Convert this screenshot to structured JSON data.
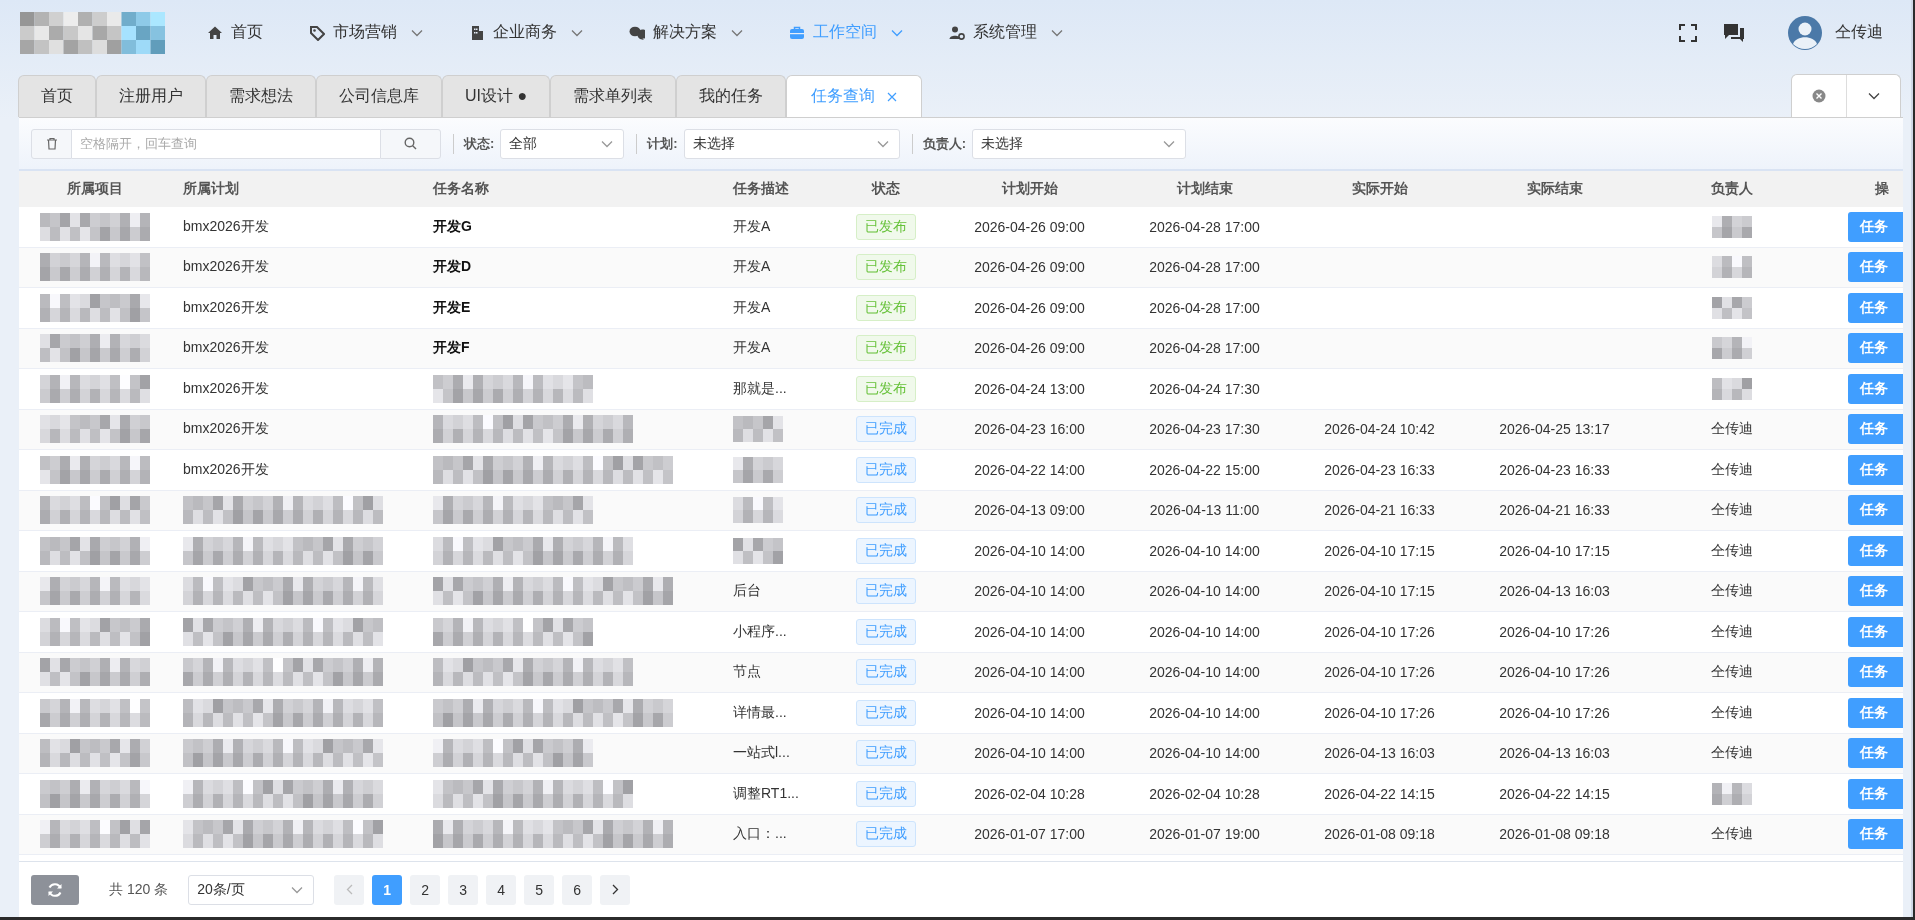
{
  "header": {
    "logo": {
      "redacted": true
    },
    "nav": [
      {
        "label": "首页",
        "has_menu": false,
        "selected": false
      },
      {
        "label": "市场营销",
        "has_menu": true,
        "selected": false
      },
      {
        "label": "企业商务",
        "has_menu": true,
        "selected": false
      },
      {
        "label": "解决方案",
        "has_menu": true,
        "selected": false
      },
      {
        "label": "工作空间",
        "has_menu": true,
        "selected": true
      },
      {
        "label": "系统管理",
        "has_menu": true,
        "selected": false
      }
    ],
    "user": {
      "name": "仝传迪"
    }
  },
  "tabs": [
    {
      "label": "首页",
      "selected": false
    },
    {
      "label": "注册用户",
      "selected": false
    },
    {
      "label": "需求想法",
      "selected": false
    },
    {
      "label": "公司信息库",
      "selected": false
    },
    {
      "label": "UI设计 ●",
      "selected": false
    },
    {
      "label": "需求单列表",
      "selected": false
    },
    {
      "label": "我的任务",
      "selected": false
    },
    {
      "label": "任务查询",
      "selected": true
    }
  ],
  "filters": {
    "search": {
      "placeholder": "空格隔开，回车查询"
    },
    "selects": [
      {
        "label": "状态:",
        "value": "全部"
      },
      {
        "label": "计划:",
        "value": "未选择"
      },
      {
        "label": "负责人:",
        "value": "未选择"
      }
    ]
  },
  "table": {
    "columns": [
      "所属项目",
      "所属计划",
      "任务名称",
      "任务描述",
      "状态",
      "计划开始",
      "计划结束",
      "实际开始",
      "实际结束",
      "负责人",
      "操"
    ],
    "rows": [
      {
        "project": {
          "redacted": true
        },
        "plan": "bmx2026开发",
        "task": "开发G",
        "bold": true,
        "desc": "开发A",
        "status": {
          "label": "已发布",
          "kind": "published"
        },
        "plan_start": "2026-04-26 09:00",
        "plan_end": "2026-04-28 17:00",
        "owner": {
          "redacted": true
        },
        "action": "任务"
      },
      {
        "project": {
          "redacted": true
        },
        "plan": "bmx2026开发",
        "task": "开发D",
        "bold": true,
        "desc": "开发A",
        "status": {
          "label": "已发布",
          "kind": "published"
        },
        "plan_start": "2026-04-26 09:00",
        "plan_end": "2026-04-28 17:00",
        "owner": {
          "redacted": true
        },
        "action": "任务"
      },
      {
        "project": {
          "redacted": true
        },
        "plan": "bmx2026开发",
        "task": "开发E",
        "bold": true,
        "desc": "开发A",
        "status": {
          "label": "已发布",
          "kind": "published"
        },
        "plan_start": "2026-04-26 09:00",
        "plan_end": "2026-04-28 17:00",
        "owner": {
          "redacted": true
        },
        "action": "任务"
      },
      {
        "project": {
          "redacted": true
        },
        "plan": "bmx2026开发",
        "task": "开发F",
        "bold": true,
        "desc": "开发A",
        "status": {
          "label": "已发布",
          "kind": "published"
        },
        "plan_start": "2026-04-26 09:00",
        "plan_end": "2026-04-28 17:00",
        "owner": {
          "redacted": true
        },
        "action": "任务"
      },
      {
        "project": {
          "redacted": true
        },
        "plan": "bmx2026开发",
        "task": {
          "redacted": true
        },
        "bold": false,
        "desc": "那就是...",
        "status": {
          "label": "已发布",
          "kind": "published"
        },
        "plan_start": "2026-04-24 13:00",
        "plan_end": "2026-04-24 17:30",
        "owner": {
          "redacted": true
        },
        "action": "任务"
      },
      {
        "project": {
          "redacted": true
        },
        "plan": "bmx2026开发",
        "task": {
          "redacted": true
        },
        "bold": false,
        "desc": {
          "redacted": true
        },
        "status": {
          "label": "已完成",
          "kind": "done"
        },
        "plan_start": "2026-04-23 16:00",
        "plan_end": "2026-04-23 17:30",
        "actual_start": "2026-04-24 10:42",
        "actual_end": "2026-04-25 13:17",
        "owner": "仝传迪",
        "action": "任务"
      },
      {
        "project": {
          "redacted": true
        },
        "plan": "bmx2026开发",
        "task": {
          "redacted": true
        },
        "bold": false,
        "desc": {
          "redacted": true
        },
        "status": {
          "label": "已完成",
          "kind": "done"
        },
        "plan_start": "2026-04-22 14:00",
        "plan_end": "2026-04-22 15:00",
        "actual_start": "2026-04-23 16:33",
        "actual_end": "2026-04-23 16:33",
        "owner": "仝传迪",
        "action": "任务"
      },
      {
        "project": {
          "redacted": true
        },
        "plan": {
          "redacted": true
        },
        "task": {
          "redacted": true
        },
        "bold": false,
        "desc": {
          "redacted": true
        },
        "status": {
          "label": "已完成",
          "kind": "done"
        },
        "plan_start": "2026-04-13 09:00",
        "plan_end": "2026-04-13 11:00",
        "actual_start": "2026-04-21 16:33",
        "actual_end": "2026-04-21 16:33",
        "owner": "仝传迪",
        "action": "任务"
      },
      {
        "project": {
          "redacted": true
        },
        "plan": {
          "redacted": true
        },
        "task": {
          "redacted": true
        },
        "bold": false,
        "desc": {
          "redacted": true
        },
        "status": {
          "label": "已完成",
          "kind": "done"
        },
        "plan_start": "2026-04-10 14:00",
        "plan_end": "2026-04-10 14:00",
        "actual_start": "2026-04-10 17:15",
        "actual_end": "2026-04-10 17:15",
        "owner": "仝传迪",
        "action": "任务"
      },
      {
        "project": {
          "redacted": true
        },
        "plan": {
          "redacted": true
        },
        "task": {
          "redacted": true
        },
        "bold": false,
        "desc": "后台",
        "status": {
          "label": "已完成",
          "kind": "done"
        },
        "plan_start": "2026-04-10 14:00",
        "plan_end": "2026-04-10 14:00",
        "actual_start": "2026-04-10 17:15",
        "actual_end": "2026-04-13 16:03",
        "owner": "仝传迪",
        "action": "任务"
      },
      {
        "project": {
          "redacted": true
        },
        "plan": {
          "redacted": true
        },
        "task": {
          "redacted": true
        },
        "bold": false,
        "desc": "小程序...",
        "status": {
          "label": "已完成",
          "kind": "done"
        },
        "plan_start": "2026-04-10 14:00",
        "plan_end": "2026-04-10 14:00",
        "actual_start": "2026-04-10 17:26",
        "actual_end": "2026-04-10 17:26",
        "owner": "仝传迪",
        "action": "任务"
      },
      {
        "project": {
          "redacted": true
        },
        "plan": {
          "redacted": true
        },
        "task": {
          "redacted": true
        },
        "bold": false,
        "desc": "节点",
        "status": {
          "label": "已完成",
          "kind": "done"
        },
        "plan_start": "2026-04-10 14:00",
        "plan_end": "2026-04-10 14:00",
        "actual_start": "2026-04-10 17:26",
        "actual_end": "2026-04-10 17:26",
        "owner": "仝传迪",
        "action": "任务"
      },
      {
        "project": {
          "redacted": true
        },
        "plan": {
          "redacted": true
        },
        "task": {
          "redacted": true
        },
        "bold": false,
        "desc": "详情最...",
        "status": {
          "label": "已完成",
          "kind": "done"
        },
        "plan_start": "2026-04-10 14:00",
        "plan_end": "2026-04-10 14:00",
        "actual_start": "2026-04-10 17:26",
        "actual_end": "2026-04-10 17:26",
        "owner": "仝传迪",
        "action": "任务"
      },
      {
        "project": {
          "redacted": true
        },
        "plan": {
          "redacted": true
        },
        "task": {
          "redacted": true
        },
        "bold": false,
        "desc": "一站式l...",
        "status": {
          "label": "已完成",
          "kind": "done"
        },
        "plan_start": "2026-04-10 14:00",
        "plan_end": "2026-04-10 14:00",
        "actual_start": "2026-04-13 16:03",
        "actual_end": "2026-04-13 16:03",
        "owner": "仝传迪",
        "action": "任务"
      },
      {
        "project": {
          "redacted": true
        },
        "plan": {
          "redacted": true
        },
        "task": {
          "redacted": true
        },
        "bold": false,
        "desc": "调整RT1...",
        "status": {
          "label": "已完成",
          "kind": "done"
        },
        "plan_start": "2026-02-04 10:28",
        "plan_end": "2026-02-04 10:28",
        "actual_start": "2026-04-22 14:15",
        "actual_end": "2026-04-22 14:15",
        "owner": {
          "redacted": true
        },
        "action": "任务"
      },
      {
        "project": {
          "redacted": true
        },
        "plan": {
          "redacted": true
        },
        "task": {
          "redacted": true
        },
        "bold": false,
        "desc": "入口：...",
        "status": {
          "label": "已完成",
          "kind": "done"
        },
        "plan_start": "2026-01-07 17:00",
        "plan_end": "2026-01-07 19:00",
        "actual_start": "2026-01-08 09:18",
        "actual_end": "2026-01-08 09:18",
        "owner": "仝传迪",
        "action": "任务"
      }
    ]
  },
  "pagination": {
    "total": "共 120 条",
    "page_size": "20条/页",
    "pages": [
      {
        "label": "1",
        "selected": true
      },
      {
        "label": "2",
        "selected": false
      },
      {
        "label": "3",
        "selected": false
      },
      {
        "label": "4",
        "selected": false
      },
      {
        "label": "5",
        "selected": false
      },
      {
        "label": "6",
        "selected": false
      }
    ],
    "prev_disabled": true
  }
}
